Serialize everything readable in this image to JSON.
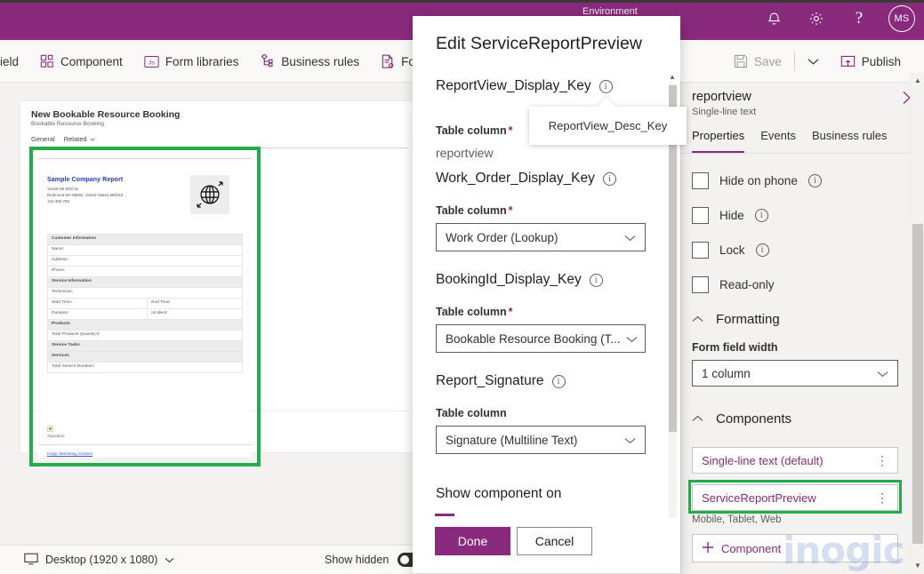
{
  "topbar": {
    "environment_label": "Environment",
    "icons": [
      "bell-icon",
      "gear-icon",
      "help-icon"
    ],
    "avatar_initials": "MS"
  },
  "commandbar": {
    "items": [
      {
        "label": "ield",
        "icon": "field-icon"
      },
      {
        "label": "Component",
        "icon": "component-icon"
      },
      {
        "label": "Form libraries",
        "icon": "js-icon"
      },
      {
        "label": "Business rules",
        "icon": "business-rules-icon"
      },
      {
        "label": "Form s",
        "icon": "form-settings-icon"
      }
    ],
    "save_label": "Save",
    "publish_label": "Publish"
  },
  "canvas": {
    "form_title": "New Bookable Resource Booking",
    "form_subtitle": "Bookable Resource Booking",
    "tabs": [
      "General",
      "Related"
    ],
    "report": {
      "company": "Sample Company Report",
      "address_lines": [
        "16160 NE 83rd St",
        "Redmond WA 98052, United States-580010",
        "123-456-789"
      ],
      "rows": [
        {
          "type": "header",
          "cells": [
            "Customer Information"
          ]
        },
        {
          "type": "row",
          "cells": [
            "Name:"
          ]
        },
        {
          "type": "row",
          "cells": [
            "Address:"
          ]
        },
        {
          "type": "row",
          "cells": [
            "Phone:"
          ]
        },
        {
          "type": "header",
          "cells": [
            "Service Information"
          ]
        },
        {
          "type": "row",
          "cells": [
            "Technician:"
          ]
        },
        {
          "type": "row",
          "cells": [
            "Start Time:",
            "End Time:"
          ]
        },
        {
          "type": "row",
          "cells": [
            "Duration:",
            "Incident:"
          ]
        },
        {
          "type": "header",
          "cells": [
            "Products"
          ]
        },
        {
          "type": "row",
          "cells": [
            "Total Products Quantity:0"
          ]
        },
        {
          "type": "header",
          "cells": [
            "Service Tasks"
          ]
        },
        {
          "type": "header",
          "cells": [
            "Services"
          ]
        },
        {
          "type": "row",
          "cells": [
            "Total Service Duration:"
          ]
        }
      ],
      "signature_label": "Signature",
      "footer_link": "Inogic Marketing Content"
    }
  },
  "statusbar": {
    "device_label": "Desktop (1920 x 1080)",
    "show_hidden_label": "Show hidden"
  },
  "rightpanel": {
    "field_name": "reportview",
    "field_type": "Single-line text",
    "tabs": [
      {
        "label": "Properties",
        "selected": true
      },
      {
        "label": "Events",
        "selected": false
      },
      {
        "label": "Business rules",
        "selected": false
      }
    ],
    "checkboxes": [
      {
        "label": "Hide on phone",
        "checked": false,
        "has_info": true
      },
      {
        "label": "Hide",
        "checked": false,
        "has_info": true
      },
      {
        "label": "Lock",
        "checked": false,
        "has_info": true
      },
      {
        "label": "Read-only",
        "checked": false,
        "has_info": false
      }
    ],
    "formatting": {
      "section_label": "Formatting",
      "field_width_label": "Form field width",
      "field_width_value": "1 column"
    },
    "components": {
      "section_label": "Components",
      "items": [
        {
          "label": "Single-line text (default)",
          "selected": false
        },
        {
          "label": "ServiceReportPreview",
          "selected": true
        }
      ],
      "selected_platforms": "Mobile, Tablet, Web",
      "add_label": "Component"
    }
  },
  "dialog": {
    "title": "Edit ServiceReportPreview",
    "groups": [
      {
        "heading": "ReportView_Display_Key",
        "sub_label": "Table column",
        "required": true,
        "value": "reportview",
        "control": "text"
      },
      {
        "heading": "Work_Order_Display_Key",
        "sub_label": "Table column",
        "required": true,
        "value": "Work Order (Lookup)",
        "control": "select"
      },
      {
        "heading": "BookingId_Display_Key",
        "sub_label": "Table column",
        "required": true,
        "value": "Bookable Resource Booking (T...",
        "control": "select"
      },
      {
        "heading": "Report_Signature",
        "sub_label": "Table column",
        "required": false,
        "value": "Signature (Multiline Text)",
        "control": "select"
      }
    ],
    "show_component_on_label": "Show component on",
    "done_label": "Done",
    "cancel_label": "Cancel"
  },
  "tooltip": {
    "text": "ReportView_Desc_Key"
  },
  "watermark": {
    "text": "inogic"
  },
  "colors": {
    "brand_purple": "#8a2a7d",
    "selection_green": "#22ac4b",
    "required_red": "#a4262c",
    "link_blue": "#3b5bc4"
  }
}
